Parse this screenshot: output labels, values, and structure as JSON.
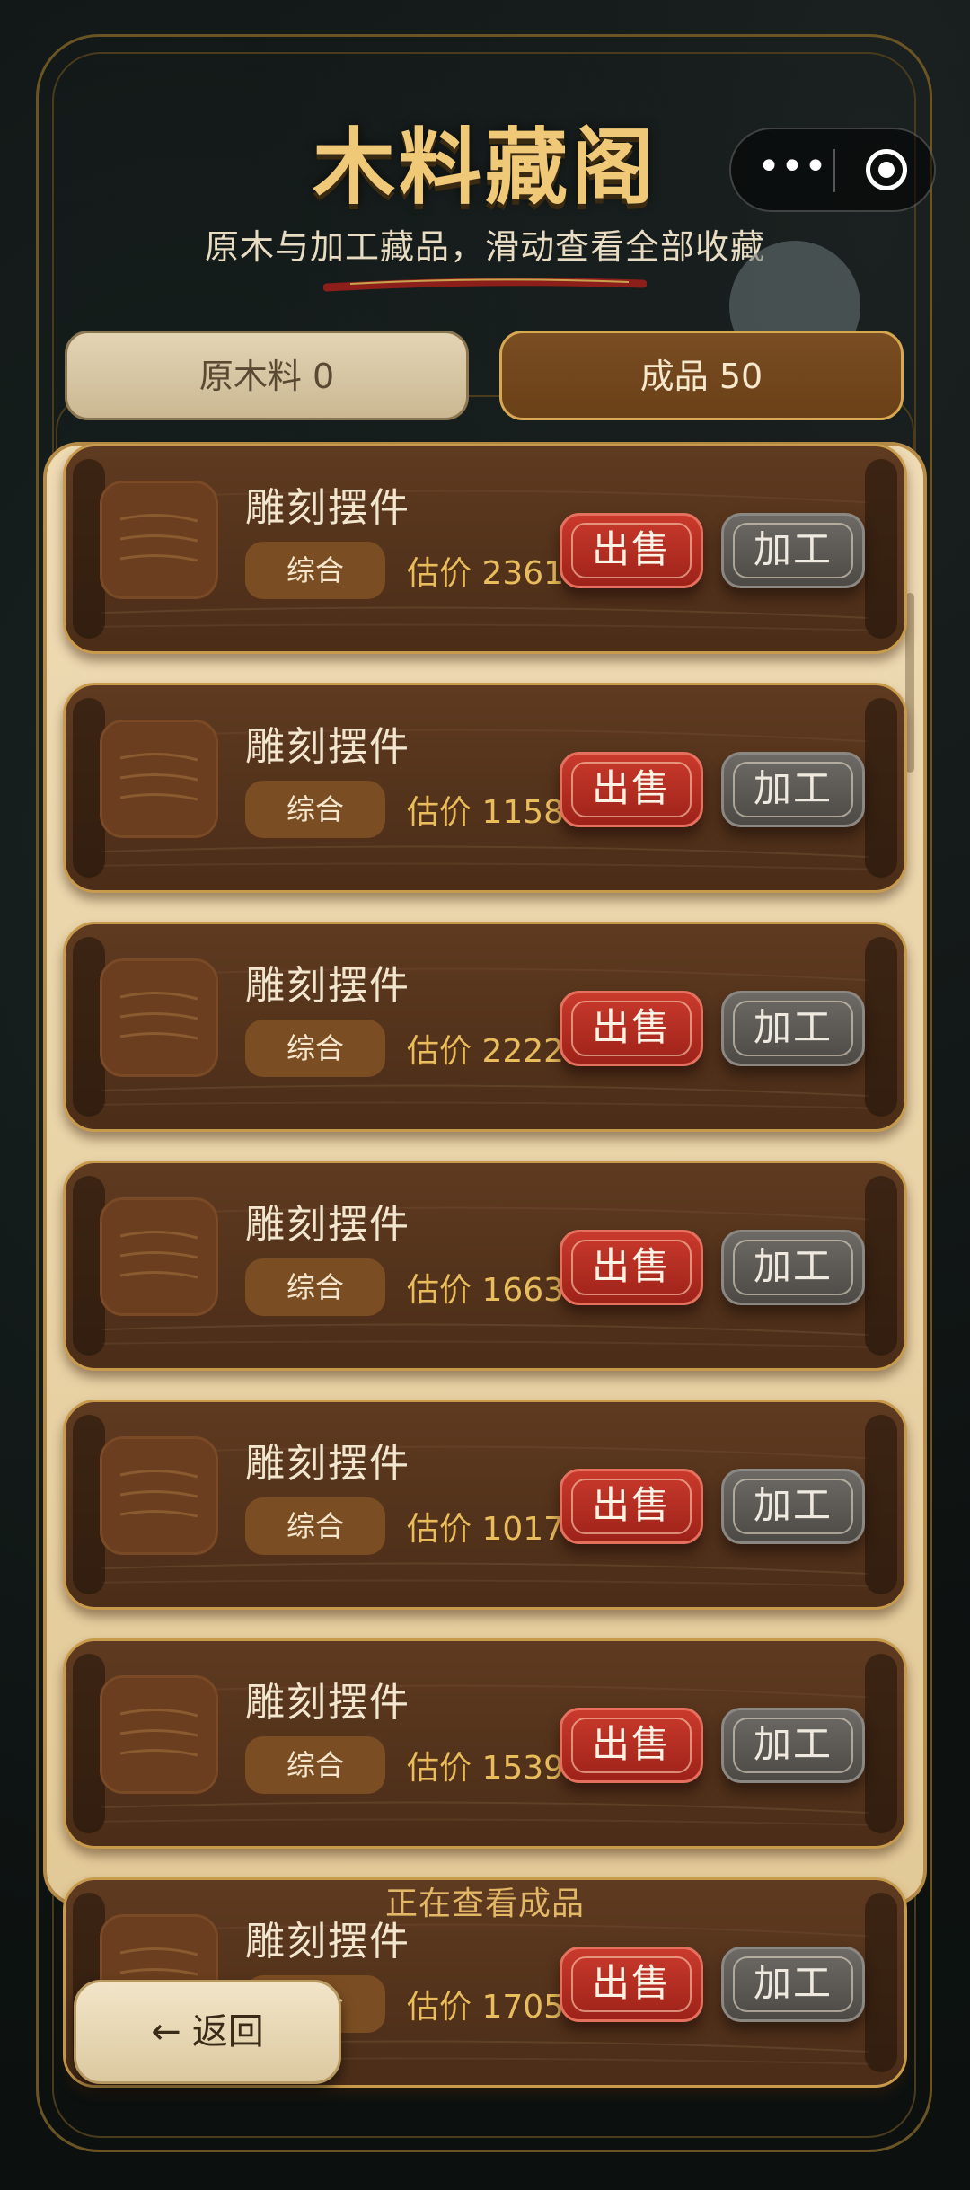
{
  "header": {
    "title": "木料藏阁",
    "subtitle": "原木与加工藏品，滑动查看全部收藏"
  },
  "tabs": [
    {
      "label": "原木料 0",
      "active": false
    },
    {
      "label": "成品 50",
      "active": true
    }
  ],
  "items": [
    {
      "name": "雕刻摆件",
      "tag": "综合",
      "price": "估价 23612",
      "sell_label": "出售",
      "process_label": "加工"
    },
    {
      "name": "雕刻摆件",
      "tag": "综合",
      "price": "估价 11588",
      "sell_label": "出售",
      "process_label": "加工"
    },
    {
      "name": "雕刻摆件",
      "tag": "综合",
      "price": "估价 22222",
      "sell_label": "出售",
      "process_label": "加工"
    },
    {
      "name": "雕刻摆件",
      "tag": "综合",
      "price": "估价 16634",
      "sell_label": "出售",
      "process_label": "加工"
    },
    {
      "name": "雕刻摆件",
      "tag": "综合",
      "price": "估价 10174",
      "sell_label": "出售",
      "process_label": "加工"
    },
    {
      "name": "雕刻摆件",
      "tag": "综合",
      "price": "估价 15394",
      "sell_label": "出售",
      "process_label": "加工"
    },
    {
      "name": "雕刻摆件",
      "tag": "综合",
      "price": "估价 17056",
      "sell_label": "出售",
      "process_label": "加工"
    }
  ],
  "status_text": "正在查看成品",
  "back_button": {
    "label": "返回",
    "icon": "left-arrow-icon"
  },
  "colors": {
    "accent_gold": "#f0c978",
    "sell_red": "#b52c21",
    "card_wood": "#553420",
    "panel_cream": "#ead6ab"
  }
}
